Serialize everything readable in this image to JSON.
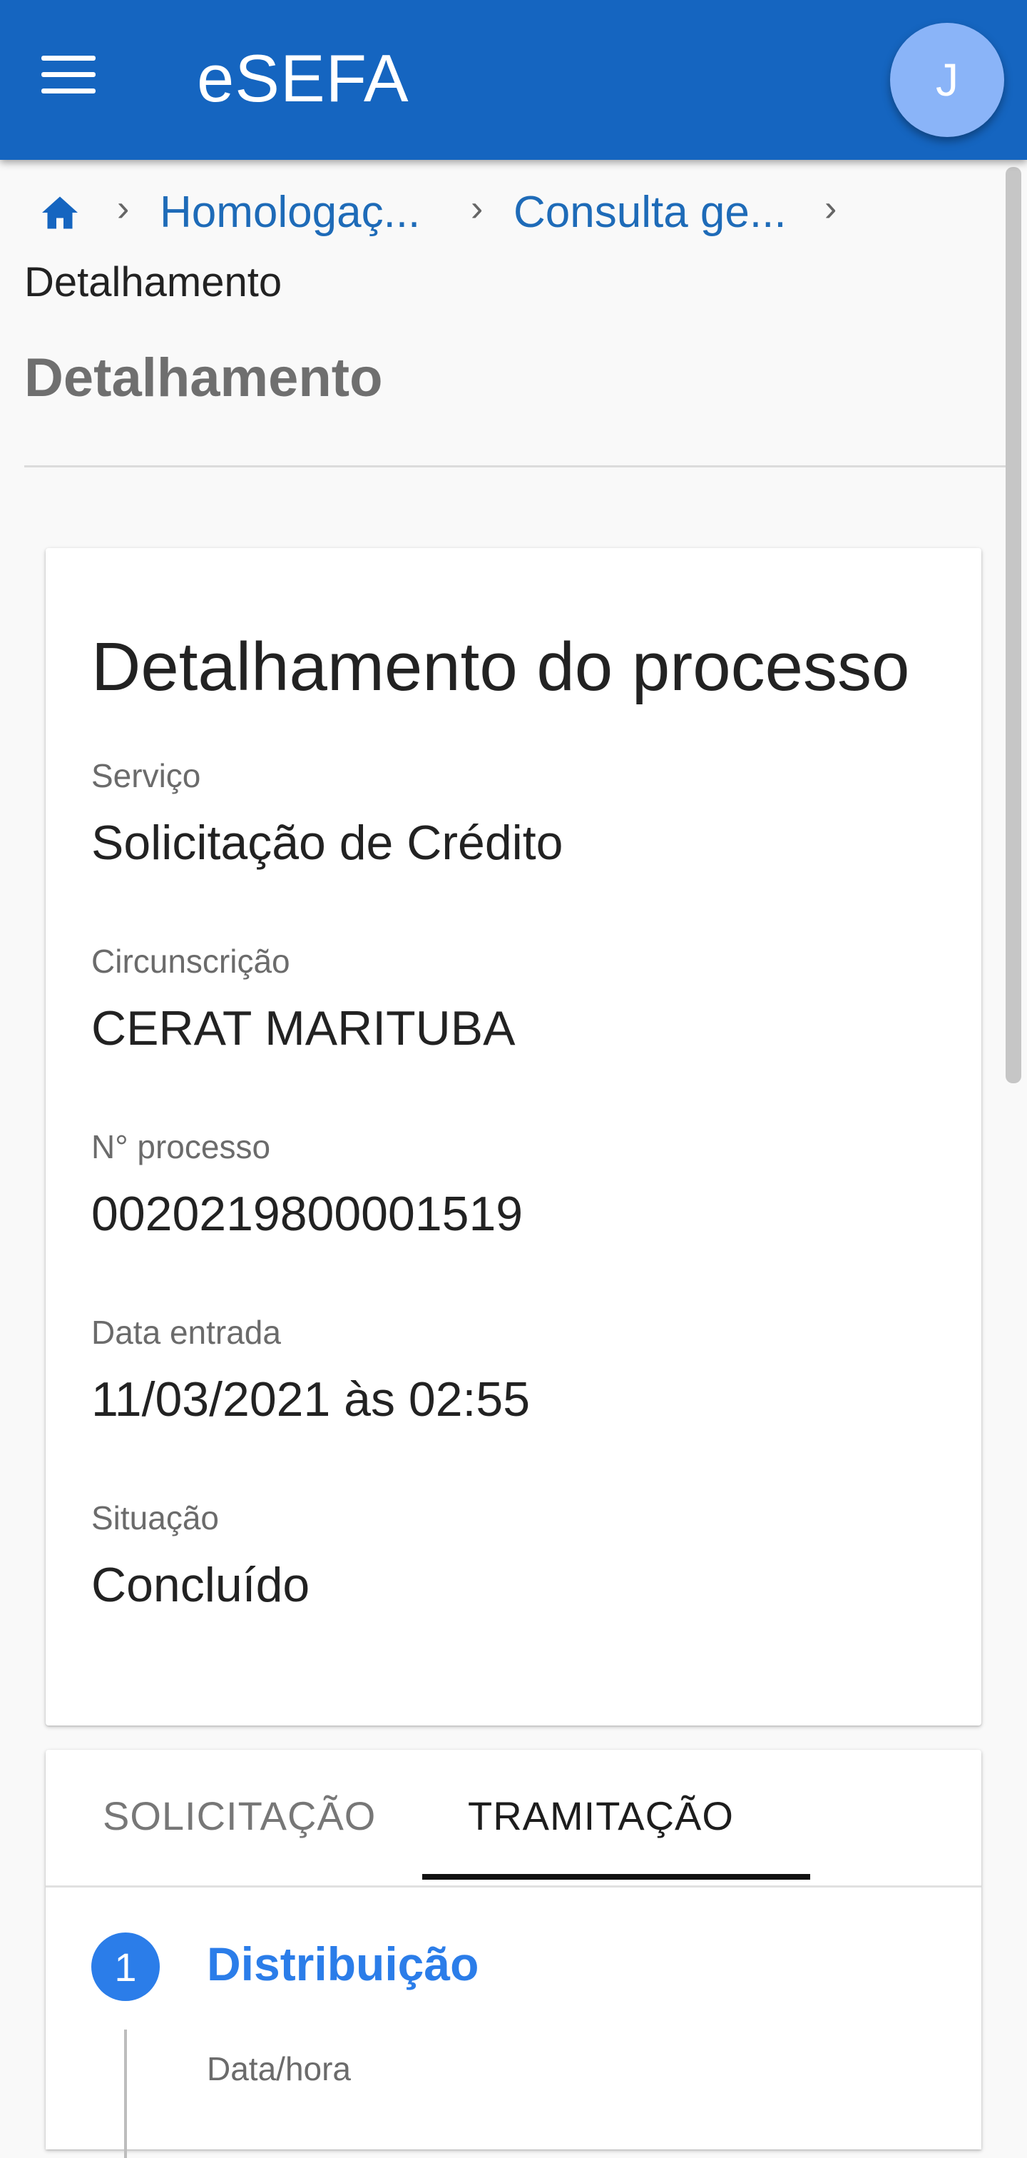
{
  "appbar": {
    "title": "eSEFA",
    "avatar_initial": "J",
    "menu_icon": "menu-icon",
    "color": "#1565c0"
  },
  "breadcrumb": {
    "home_icon": "home-icon",
    "items": [
      "Homologaç...",
      "Consulta ge..."
    ],
    "current": "Detalhamento"
  },
  "page": {
    "title": "Detalhamento"
  },
  "details": {
    "title": "Detalhamento do processo",
    "fields": [
      {
        "label": "Serviço",
        "value": "Solicitação de Crédito"
      },
      {
        "label": "Circunscrição",
        "value": "CERAT MARITUBA"
      },
      {
        "label": "N° processo",
        "value": "0020219800001519"
      },
      {
        "label": "Data entrada",
        "value": "11/03/2021 às 02:55"
      },
      {
        "label": "Situação",
        "value": "Concluído"
      }
    ]
  },
  "tabs": {
    "items": [
      "SOLICITAÇÃO",
      "TRAMITAÇÃO"
    ],
    "active": "TRAMITAÇÃO"
  },
  "steps": [
    {
      "number": "1",
      "title": "Distribuição",
      "sub_label": "Data/hora"
    }
  ],
  "colors": {
    "accent": "#2b7de9",
    "link": "#1e6bb8"
  }
}
